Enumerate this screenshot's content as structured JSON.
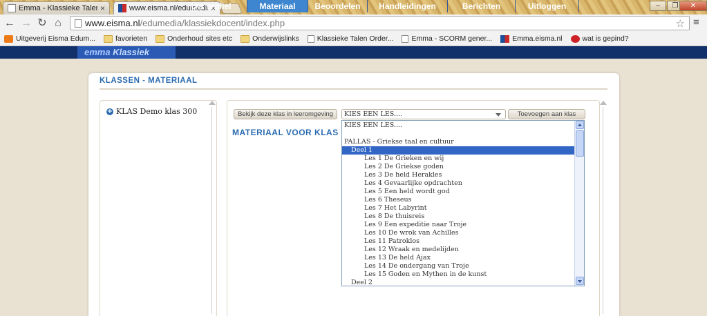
{
  "browser": {
    "tabs": [
      {
        "title": "Emma - Klassieke Talen",
        "active": false
      },
      {
        "title": "www.eisma.nl/edumedia/kla",
        "active": true
      }
    ],
    "url_host": "www.eisma.nl",
    "url_path": "/edumedia/klassiekdocent/index.php",
    "bookmarks": [
      {
        "label": "Uitgeverij Eisma Edum...",
        "icon": "blogger-icon"
      },
      {
        "label": "favorieten",
        "icon": "folder-icon"
      },
      {
        "label": "Onderhoud sites etc",
        "icon": "folder-icon"
      },
      {
        "label": "Onderwijslinks",
        "icon": "folder-icon"
      },
      {
        "label": "Klassieke Talen Order...",
        "icon": "page-icon"
      },
      {
        "label": "Emma - SCORM gener...",
        "icon": "page-icon"
      },
      {
        "label": "Emma.eisma.nl",
        "icon": "eisma-icon"
      },
      {
        "label": "wat is gepind?",
        "icon": "pinterest-icon"
      }
    ]
  },
  "site": {
    "logo_a": "emma",
    "logo_b": "Klassiek",
    "nav": [
      {
        "label": "Uw profiel",
        "active": false
      },
      {
        "label": "Materiaal",
        "active": true
      },
      {
        "label": "Beoordelen",
        "active": false
      },
      {
        "label": "Handleidingen",
        "active": false
      },
      {
        "label": "Berichten",
        "active": false
      },
      {
        "label": "Uitloggen",
        "active": false
      }
    ],
    "accent_color": "#2a6bb0",
    "nav_color": "#12306a"
  },
  "page": {
    "title": "KLASSEN - MATERIAAL",
    "class_name": "KLAS Demo klas 300",
    "view_button": "Bekijk deze klas in leeromgeving",
    "add_button": "Toevoegen aan klas",
    "select_value": "KIES EEN LES....",
    "material_heading": "MATERIAAL VOOR KLAS D"
  },
  "dropdown": {
    "options": [
      {
        "label": "KIES EEN LES....",
        "level": 0,
        "selected": false
      },
      {
        "label": "",
        "level": 0,
        "selected": false
      },
      {
        "label": "PALLAS - Griekse taal en cultuur",
        "level": 0,
        "selected": false
      },
      {
        "label": "Deel 1",
        "level": 1,
        "selected": true
      },
      {
        "label": "Les 1 De Grieken en wij",
        "level": 2,
        "selected": false
      },
      {
        "label": "Les 2 De Griekse goden",
        "level": 2,
        "selected": false
      },
      {
        "label": "Les 3 De held Herakles",
        "level": 2,
        "selected": false
      },
      {
        "label": "Les 4 Gevaarlijke opdrachten",
        "level": 2,
        "selected": false
      },
      {
        "label": "Les 5 Een held wordt god",
        "level": 2,
        "selected": false
      },
      {
        "label": "Les 6 Theseus",
        "level": 2,
        "selected": false
      },
      {
        "label": "Les 7 Het Labyrint",
        "level": 2,
        "selected": false
      },
      {
        "label": "Les 8 De thuisreis",
        "level": 2,
        "selected": false
      },
      {
        "label": "Les 9 Een expeditie naar Troje",
        "level": 2,
        "selected": false
      },
      {
        "label": "Les 10 De wrok van Achilles",
        "level": 2,
        "selected": false
      },
      {
        "label": "Les 11 Patroklos",
        "level": 2,
        "selected": false
      },
      {
        "label": "Les 12 Wraak en medelijden",
        "level": 2,
        "selected": false
      },
      {
        "label": "Les 13 De held Ajax",
        "level": 2,
        "selected": false
      },
      {
        "label": "Les 14 De ondergang van Troje",
        "level": 2,
        "selected": false
      },
      {
        "label": "Les 15 Goden en Mythen in de kunst",
        "level": 2,
        "selected": false
      },
      {
        "label": "Deel 2",
        "level": 1,
        "selected": false
      }
    ],
    "selected_color": "#3166c5"
  }
}
